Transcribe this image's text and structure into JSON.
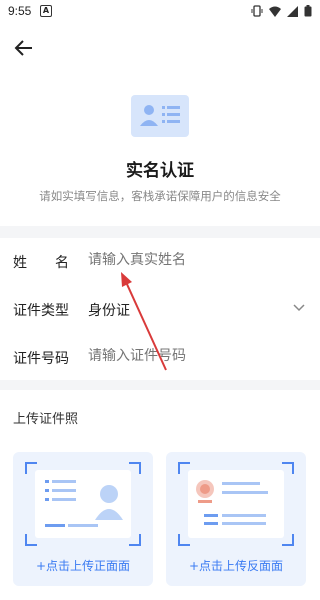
{
  "status_bar": {
    "time": "9:55",
    "notification_icon": "A"
  },
  "header": {
    "back_icon": "arrow-left-icon"
  },
  "hero": {
    "title": "实名认证",
    "subtitle": "请如实填写信息，客栈承诺保障用户的信息安全"
  },
  "form": {
    "name": {
      "label_chars": [
        "姓",
        "名"
      ],
      "placeholder": "请输入真实姓名"
    },
    "id_type": {
      "label": "证件类型",
      "value": "身份证"
    },
    "id_number": {
      "label": "证件号码",
      "placeholder": "请输入证件号码"
    }
  },
  "upload": {
    "title": "上传证件照",
    "front_label": "+点击上传正面面",
    "back_label": "+点击上传反面面"
  },
  "colors": {
    "accent": "#3a7bf2",
    "annotation_arrow": "#d93a3a"
  }
}
